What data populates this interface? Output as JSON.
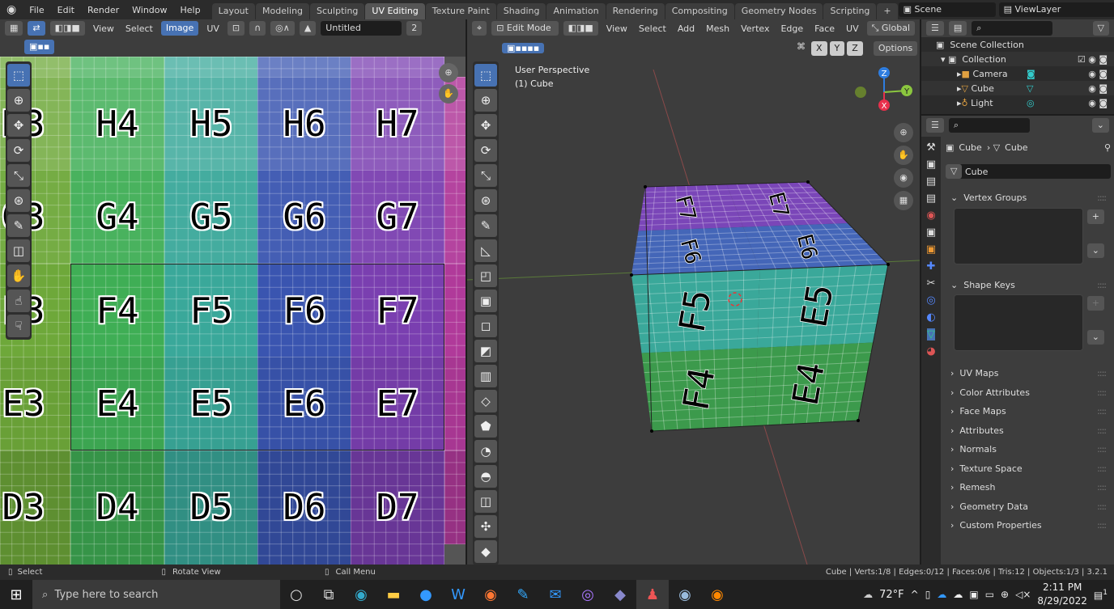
{
  "menubar": {
    "items": [
      "File",
      "Edit",
      "Render",
      "Window",
      "Help"
    ]
  },
  "workspaces": [
    "Layout",
    "Modeling",
    "Sculpting",
    "UV Editing",
    "Texture Paint",
    "Shading",
    "Animation",
    "Rendering",
    "Compositing",
    "Geometry Nodes",
    "Scripting"
  ],
  "active_workspace": "UV Editing",
  "scene": "Scene",
  "view_layer": "ViewLayer",
  "uv_editor": {
    "menus": [
      "View",
      "Select",
      "Image",
      "UV"
    ],
    "active_menu": "Image",
    "image_name": "Untitled",
    "image_users": "2",
    "cols": [
      "3",
      "4",
      "5",
      "6",
      "7"
    ],
    "rows": [
      "H",
      "G",
      "F",
      "E",
      "D"
    ],
    "col_colors": [
      "#6ea83a",
      "#3fae55",
      "#3aa89a",
      "#3a55b0",
      "#7a3fb0"
    ]
  },
  "viewport": {
    "mode": "Edit Mode",
    "menus": [
      "View",
      "Select",
      "Add",
      "Mesh",
      "Vertex",
      "Edge",
      "Face",
      "UV"
    ],
    "orientation": "Global",
    "axes": [
      "X",
      "Y",
      "Z"
    ],
    "options": "Options",
    "overlay_line1": "User Perspective",
    "overlay_line2": "(1) Cube",
    "cube_labels": {
      "top": [
        "F7",
        "E7",
        "F6",
        "E6"
      ],
      "front": [
        "F5",
        "E5",
        "F4",
        "E4"
      ]
    }
  },
  "outliner": {
    "root": "Scene Collection",
    "collection": "Collection",
    "items": [
      "Camera",
      "Cube",
      "Light"
    ]
  },
  "properties": {
    "breadcrumb_object": "Cube",
    "breadcrumb_mesh": "Cube",
    "mesh_name": "Cube",
    "sections_open": [
      "Vertex Groups",
      "Shape Keys"
    ],
    "sections": [
      "UV Maps",
      "Color Attributes",
      "Face Maps",
      "Attributes",
      "Normals",
      "Texture Space",
      "Remesh",
      "Geometry Data",
      "Custom Properties"
    ]
  },
  "statusbar": {
    "select": "Select",
    "rotate": "Rotate View",
    "menu": "Call Menu",
    "stats": "Cube | Verts:1/8 | Edges:0/12 | Faces:0/6 | Tris:12 | Objects:1/3 | 3.2.1"
  },
  "taskbar": {
    "search": "Type here to search",
    "weather": "72°F",
    "time": "2:11 PM",
    "date": "8/29/2022",
    "notifications": "1"
  }
}
